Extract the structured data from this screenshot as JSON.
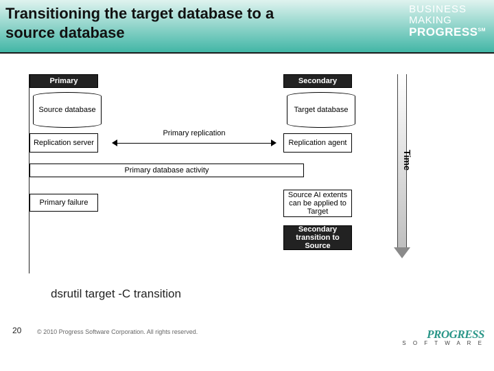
{
  "header": {
    "title": "Transitioning the target database to a source database",
    "logo_line1": "BUSINESS",
    "logo_line2": "MAKING",
    "logo_line3": "PROGRESS",
    "logo_sm": "SM"
  },
  "diagram": {
    "left": {
      "primary": "Primary",
      "source_db": "Source database",
      "repl_server": "Replication server",
      "primary_failure": "Primary failure"
    },
    "right": {
      "secondary": "Secondary",
      "target_db": "Target database",
      "repl_agent": "Replication agent",
      "ai_extents": "Source AI extents can be applied to Target",
      "transition": "Secondary transition to Source"
    },
    "center": {
      "primary_replication": "Primary replication",
      "primary_activity": "Primary database activity"
    },
    "time_label": "Time"
  },
  "footer": {
    "command": "dsrutil target -C transition",
    "slide_number": "20",
    "copyright": "© 2010 Progress Software Corporation. All rights reserved.",
    "brand_main": "PROGRESS",
    "brand_sub": "S O F T W A R E"
  }
}
